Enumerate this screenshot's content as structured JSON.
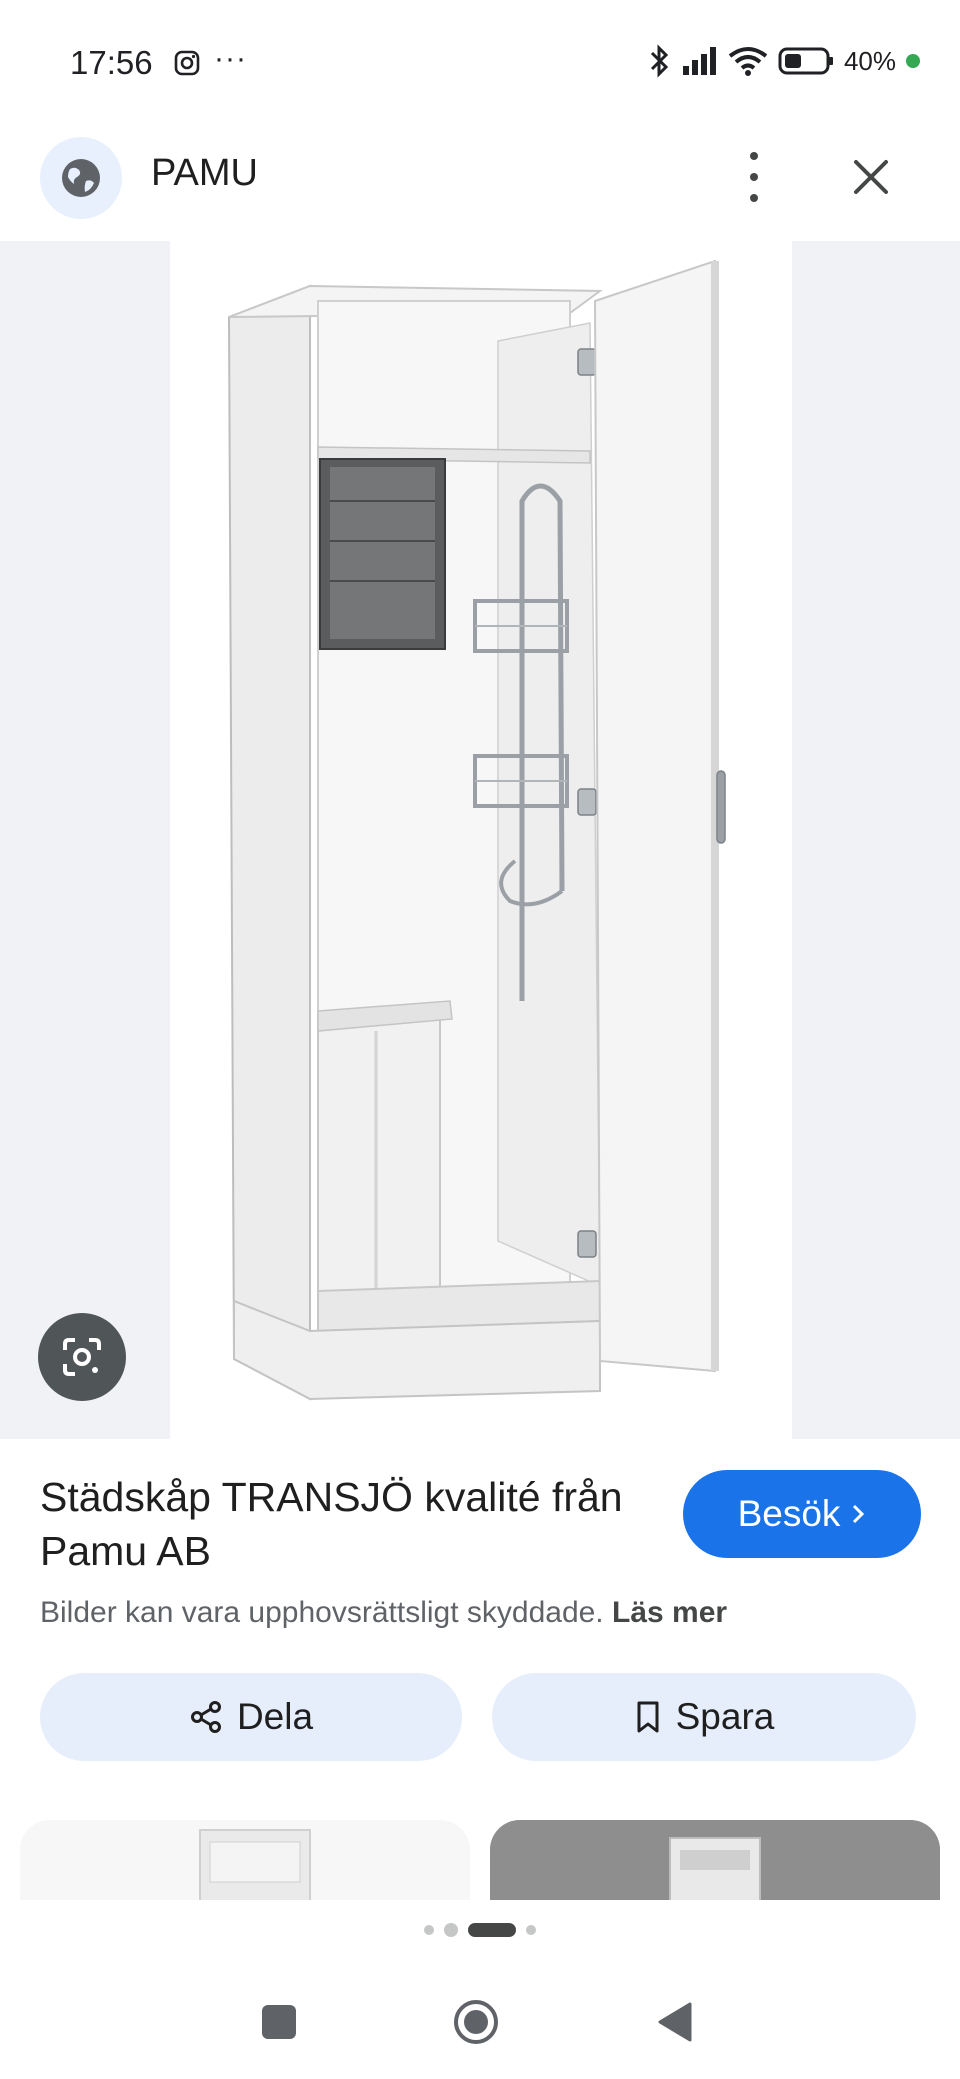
{
  "status_bar": {
    "time": "17:56",
    "more": "···",
    "battery": "40%",
    "icons": [
      "instagram-icon",
      "bluetooth-icon",
      "signal-icon",
      "wifi-icon",
      "battery-icon"
    ]
  },
  "header": {
    "site_name": "PAMU",
    "icons": [
      "globe-icon",
      "more-vert-icon",
      "close-icon"
    ]
  },
  "result": {
    "title": "Städskåp TRANSJÖ kvalité från Pamu AB",
    "visit_label": "Besök",
    "disclaimer": "Bilder kan vara upphovsrättsligt skyddade.",
    "read_more": "Läs mer"
  },
  "actions": {
    "share_label": "Dela",
    "save_label": "Spara"
  },
  "carousel": {
    "page_count": 4,
    "active_page": 3
  },
  "colors": {
    "accent": "#1a73e8",
    "pill_bg": "#e6eefc",
    "status_dot": "#34a853"
  }
}
